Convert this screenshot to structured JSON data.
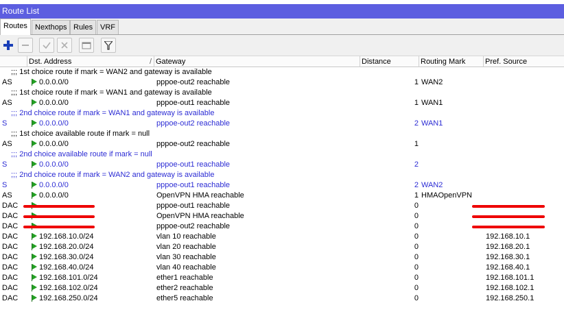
{
  "window": {
    "title": "Route List"
  },
  "tabs": [
    {
      "label": "Routes",
      "active": true
    },
    {
      "label": "Nexthops",
      "active": false
    },
    {
      "label": "Rules",
      "active": false
    },
    {
      "label": "VRF",
      "active": false
    }
  ],
  "toolbar": {
    "buttons": [
      "add-icon",
      "remove-icon",
      "enable-icon",
      "disable-icon",
      "comment-icon",
      "filter-icon"
    ]
  },
  "columns": {
    "flags": "",
    "dst": "Dst. Address",
    "gateway": "Gateway",
    "distance": "Distance",
    "mark": "Routing Mark",
    "pref": "Pref. Source"
  },
  "rows": [
    {
      "type": "comment",
      "text": ";;; 1st choice route if mark = WAN2 and gateway is available",
      "blue": false
    },
    {
      "type": "route",
      "flags": "AS",
      "dst": "0.0.0.0/0",
      "gateway": "pppoe-out2 reachable",
      "distance": "1",
      "mark": "WAN2",
      "pref": "",
      "blue": false
    },
    {
      "type": "comment",
      "text": ";;; 1st choice route if mark = WAN1 and gateway is available",
      "blue": false
    },
    {
      "type": "route",
      "flags": "AS",
      "dst": "0.0.0.0/0",
      "gateway": "pppoe-out1 reachable",
      "distance": "1",
      "mark": "WAN1",
      "pref": "",
      "blue": false
    },
    {
      "type": "comment",
      "text": ";;; 2nd choice route if mark = WAN1 and gateway is available",
      "blue": true
    },
    {
      "type": "route",
      "flags": "S",
      "dst": "0.0.0.0/0",
      "gateway": "pppoe-out2 reachable",
      "distance": "2",
      "mark": "WAN1",
      "pref": "",
      "blue": true
    },
    {
      "type": "comment",
      "text": ";;; 1st choice available route if mark = null",
      "blue": false
    },
    {
      "type": "route",
      "flags": "AS",
      "dst": "0.0.0.0/0",
      "gateway": "pppoe-out2 reachable",
      "distance": "1",
      "mark": "",
      "pref": "",
      "blue": false
    },
    {
      "type": "comment",
      "text": ";;; 2nd choice available route if mark = null",
      "blue": true
    },
    {
      "type": "route",
      "flags": "S",
      "dst": "0.0.0.0/0",
      "gateway": "pppoe-out1 reachable",
      "distance": "2",
      "mark": "",
      "pref": "",
      "blue": true
    },
    {
      "type": "comment",
      "text": ";;; 2nd choice route if mark = WAN2 and gateway is available",
      "blue": true
    },
    {
      "type": "route",
      "flags": "S",
      "dst": "0.0.0.0/0",
      "gateway": "pppoe-out1 reachable",
      "distance": "2",
      "mark": "WAN2",
      "pref": "",
      "blue": true
    },
    {
      "type": "route",
      "flags": "AS",
      "dst": "0.0.0.0/0",
      "gateway": "OpenVPN HMA reachable",
      "distance": "1",
      "mark": "HMAOpenVPN",
      "pref": "",
      "blue": false
    },
    {
      "type": "route",
      "flags": "DAC",
      "dst": "",
      "gateway": "pppoe-out1 reachable",
      "distance": "0",
      "mark": "",
      "pref": "",
      "blue": false,
      "redact_dst": true,
      "redact_pref": true
    },
    {
      "type": "route",
      "flags": "DAC",
      "dst": "",
      "gateway": "OpenVPN HMA reachable",
      "distance": "0",
      "mark": "",
      "pref": "",
      "blue": false,
      "redact_dst": true,
      "redact_pref": true
    },
    {
      "type": "route",
      "flags": "DAC",
      "dst": "",
      "gateway": "pppoe-out2 reachable",
      "distance": "0",
      "mark": "",
      "pref": "",
      "blue": false,
      "redact_dst": true,
      "redact_pref": true
    },
    {
      "type": "route",
      "flags": "DAC",
      "dst": "192.168.10.0/24",
      "gateway": "vlan 10 reachable",
      "distance": "0",
      "mark": "",
      "pref": "192.168.10.1",
      "blue": false
    },
    {
      "type": "route",
      "flags": "DAC",
      "dst": "192.168.20.0/24",
      "gateway": "vlan 20 reachable",
      "distance": "0",
      "mark": "",
      "pref": "192.168.20.1",
      "blue": false
    },
    {
      "type": "route",
      "flags": "DAC",
      "dst": "192.168.30.0/24",
      "gateway": "vlan 30 reachable",
      "distance": "0",
      "mark": "",
      "pref": "192.168.30.1",
      "blue": false
    },
    {
      "type": "route",
      "flags": "DAC",
      "dst": "192.168.40.0/24",
      "gateway": "vlan 40 reachable",
      "distance": "0",
      "mark": "",
      "pref": "192.168.40.1",
      "blue": false
    },
    {
      "type": "route",
      "flags": "DAC",
      "dst": "192.168.101.0/24",
      "gateway": "ether1 reachable",
      "distance": "0",
      "mark": "",
      "pref": "192.168.101.1",
      "blue": false
    },
    {
      "type": "route",
      "flags": "DAC",
      "dst": "192.168.102.0/24",
      "gateway": "ether2 reachable",
      "distance": "0",
      "mark": "",
      "pref": "192.168.102.1",
      "blue": false
    },
    {
      "type": "route",
      "flags": "DAC",
      "dst": "192.168.250.0/24",
      "gateway": "ether5 reachable",
      "distance": "0",
      "mark": "",
      "pref": "192.168.250.1",
      "blue": false
    }
  ]
}
